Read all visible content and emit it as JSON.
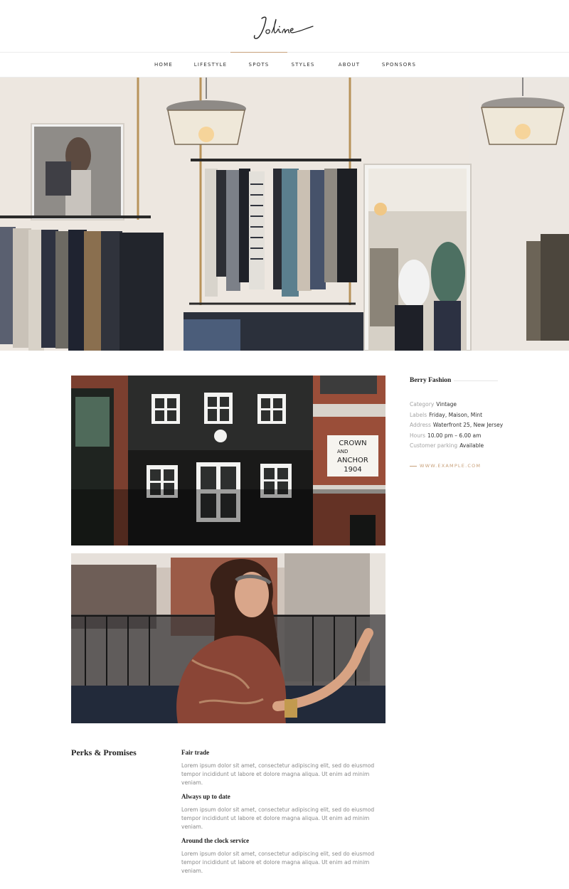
{
  "brand": {
    "logo_text": "Joline"
  },
  "nav": {
    "items": [
      {
        "label": "HOME"
      },
      {
        "label": "LIFESTYLE"
      },
      {
        "label": "SPOTS",
        "active": true
      },
      {
        "label": "STYLES"
      },
      {
        "label": "ABOUT"
      },
      {
        "label": "SPONSORS"
      }
    ]
  },
  "photos": {
    "building_sign": {
      "line1": "CROWN",
      "line2": "AND",
      "line3": "ANCHOR",
      "line4": "1904"
    }
  },
  "sidebar": {
    "title": "Berry Fashion",
    "info": [
      {
        "label": "Category",
        "value": "Vintage"
      },
      {
        "label": "Labels",
        "value": "Friday, Maison, Mint"
      },
      {
        "label": "Address",
        "value": "Waterfront 25, New Jersey"
      },
      {
        "label": "Hours",
        "value": "10.00 pm – 6.00 am"
      },
      {
        "label": "Customer parking",
        "value": "Available"
      }
    ],
    "link": "WWW.EXAMPLE.COM"
  },
  "perks": {
    "title": "Perks & Promises",
    "items": [
      {
        "title": "Fair trade",
        "text": "Lorem ipsum dolor sit amet, consectetur adipiscing elit, sed do eiusmod tempor incididunt ut labore et dolore magna aliqua. Ut enim ad minim veniam."
      },
      {
        "title": "Always up to date",
        "text": "Lorem ipsum dolor sit amet, consectetur adipiscing elit, sed do eiusmod tempor incididunt ut labore et dolore magna aliqua. Ut enim ad minim veniam."
      },
      {
        "title": "Around the clock service",
        "text": "Lorem ipsum dolor sit amet, consectetur adipiscing elit, sed do eiusmod tempor incididunt ut labore et dolore magna aliqua. Ut enim ad minim veniam."
      }
    ]
  }
}
